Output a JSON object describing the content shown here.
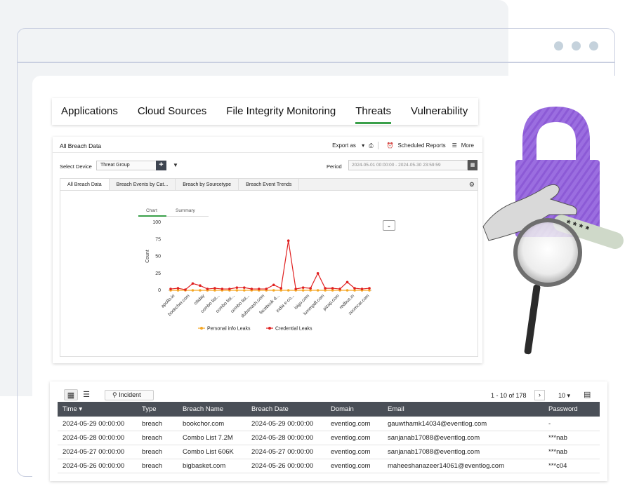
{
  "window": {
    "dots": [
      "#c5d2dc",
      "#c5d2dc",
      "#c5d2dc"
    ]
  },
  "main_tabs": [
    {
      "label": "Applications",
      "active": false
    },
    {
      "label": "Cloud Sources",
      "active": false
    },
    {
      "label": "File Integrity Monitoring",
      "active": false
    },
    {
      "label": "Threats",
      "active": true
    },
    {
      "label": "Vulnerability",
      "active": false
    }
  ],
  "breach_panel": {
    "title": "All Breach Data",
    "export_label": "Export as",
    "scheduled_reports_label": "Scheduled Reports",
    "more_label": "More",
    "select_device_label": "Select Device",
    "device_value": "Threat Group",
    "period_label": "Period",
    "period_value": "2024-05-01 00:00:00 - 2024-05-30 23:59:59",
    "tabs": [
      "All Breach Data",
      "Breach Events by Cat...",
      "Breach by Sourcetype",
      "Breach Event Trends"
    ],
    "sub_tabs": [
      "Chart",
      "Summary"
    ]
  },
  "chart_data": {
    "type": "line",
    "ylabel": "Count",
    "ylim": [
      0,
      100
    ],
    "yticks": [
      0,
      25,
      50,
      75,
      100
    ],
    "grid": false,
    "legend_position": "bottom",
    "x_tick_labels": [
      "apollo.io",
      "bookchor.com",
      "citiday",
      "combo list...",
      "combo list...",
      "combo list...",
      "dubsmash.com",
      "facebook d...",
      "india e-co...",
      "isigo.com",
      "lummpdf.com",
      "pizap.com",
      "redbus.in",
      "zoomcar.com"
    ],
    "x": [
      1,
      2,
      3,
      4,
      5,
      6,
      7,
      8,
      9,
      10,
      11,
      12,
      13,
      14,
      15,
      16,
      17,
      18,
      19,
      20,
      21,
      22,
      23,
      24,
      25,
      26,
      27,
      28
    ],
    "series": [
      {
        "name": "Personal info Leaks",
        "color": "#f5a623",
        "values": [
          0,
          0,
          0,
          0,
          0,
          0,
          0,
          0,
          0,
          0,
          0,
          0,
          0,
          0,
          0,
          0,
          0,
          0,
          0,
          0,
          0,
          0,
          0,
          0,
          0,
          0,
          0,
          0
        ]
      },
      {
        "name": "Credential Leaks",
        "color": "#e02020",
        "values": [
          2,
          3,
          1,
          10,
          7,
          2,
          3,
          2,
          2,
          4,
          4,
          2,
          2,
          2,
          8,
          3,
          73,
          2,
          4,
          3,
          25,
          3,
          3,
          2,
          12,
          3,
          2,
          3
        ]
      }
    ]
  },
  "table": {
    "toolbar": {
      "incident_label": "Incident",
      "pagination": "1 - 10 of 178",
      "per_page": "10"
    },
    "columns": [
      "Time",
      "Type",
      "Breach Name",
      "Breach Date",
      "Domain",
      "Email",
      "Password"
    ],
    "rows": [
      [
        "2024-05-29 00:00:00",
        "breach",
        "bookchor.com",
        "2024-05-29 00:00:00",
        "eventlog.com",
        "gauwthamk14034@eventlog.com",
        "-"
      ],
      [
        "2024-05-28 00:00:00",
        "breach",
        "Combo List 7.2M",
        "2024-05-28 00:00:00",
        "eventlog.com",
        "sanjanab17088@eventlog.com",
        "***nab"
      ],
      [
        "2024-05-27 00:00:00",
        "breach",
        "Combo List 606K",
        "2024-05-27 00:00:00",
        "eventlog.com",
        "sanjanab17088@eventlog.com",
        "***nab"
      ],
      [
        "2024-05-26 00:00:00",
        "breach",
        "bigbasket.com",
        "2024-05-26 00:00:00",
        "eventlog.com",
        "maheeshanazeer14061@eventlog.com",
        "***c04"
      ]
    ]
  },
  "illustration": {
    "lock_color": "#9b6ee0",
    "password_mask": "* * * *"
  }
}
